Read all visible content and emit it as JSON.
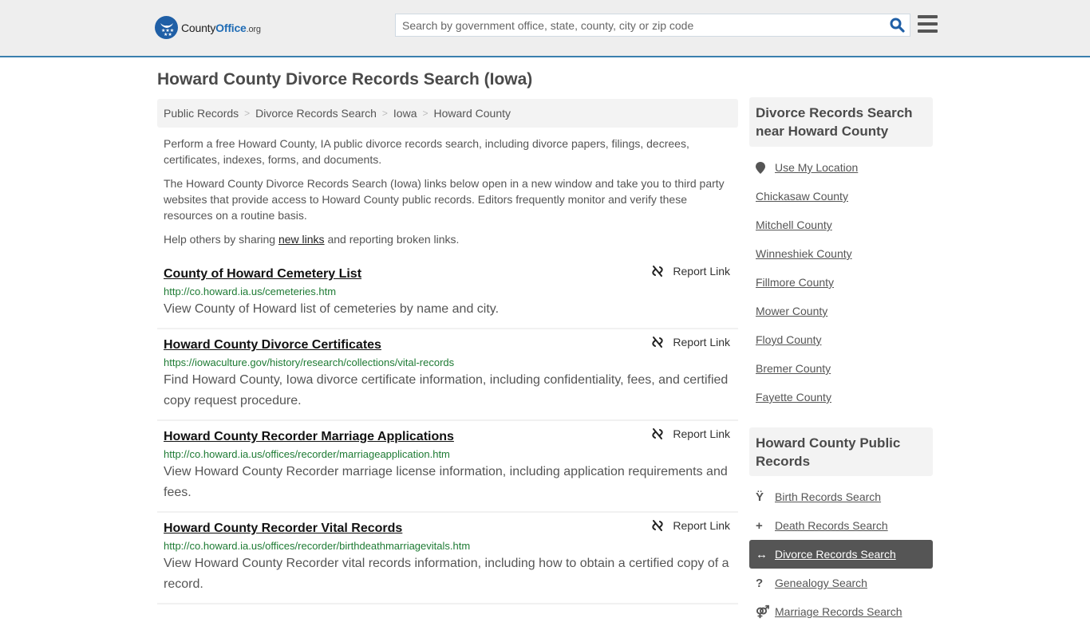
{
  "header": {
    "logo": {
      "part1": "County",
      "part2": "Office",
      "part3": ".org"
    },
    "search": {
      "placeholder": "Search by government office, state, county, city or zip code",
      "value": ""
    },
    "icons": {
      "search": "search-icon",
      "menu": "hamburger-menu-icon"
    }
  },
  "page": {
    "title": "Howard County Divorce Records Search (Iowa)",
    "breadcrumb": [
      "Public Records",
      "Divorce Records Search",
      "Iowa",
      "Howard County"
    ],
    "intro": {
      "p1": "Perform a free Howard County, IA public divorce records search, including divorce papers, filings, decrees, certificates, indexes, forms, and documents.",
      "p2": "The Howard County Divorce Records Search (Iowa) links below open in a new window and take you to third party websites that provide access to Howard County public records. Editors frequently monitor and verify these resources on a routine basis.",
      "p3_before": "Help others by sharing ",
      "p3_link": "new links",
      "p3_after": " and reporting broken links."
    }
  },
  "results": [
    {
      "title": "County of Howard Cemetery List",
      "url": "http://co.howard.ia.us/cemeteries.htm",
      "description": "View County of Howard list of cemeteries by name and city.",
      "report_label": "Report Link"
    },
    {
      "title": "Howard County Divorce Certificates",
      "url": "https://iowaculture.gov/history/research/collections/vital-records",
      "description": "Find Howard County, Iowa divorce certificate information, including confidentiality, fees, and certified copy request procedure.",
      "report_label": "Report Link"
    },
    {
      "title": "Howard County Recorder Marriage Applications",
      "url": "http://co.howard.ia.us/offices/recorder/marriageapplication.htm",
      "description": "View Howard County Recorder marriage license information, including application requirements and fees.",
      "report_label": "Report Link"
    },
    {
      "title": "Howard County Recorder Vital Records",
      "url": "http://co.howard.ia.us/offices/recorder/birthdeathmarriagevitals.htm",
      "description": "View Howard County Recorder vital records information, including how to obtain a certified copy of a record.",
      "report_label": "Report Link"
    }
  ],
  "sidebar": {
    "nearby": {
      "heading": "Divorce Records Search near Howard County",
      "use_location": "Use My Location",
      "counties": [
        "Chickasaw County",
        "Mitchell County",
        "Winneshiek County",
        "Fillmore County",
        "Mower County",
        "Floyd County",
        "Bremer County",
        "Fayette County"
      ]
    },
    "public_records": {
      "heading": "Howard County Public Records",
      "items": [
        {
          "label": "Birth Records Search",
          "icon": "child-icon",
          "glyph": "Ÿ",
          "active": false
        },
        {
          "label": "Death Records Search",
          "icon": "cross-icon",
          "glyph": "+",
          "active": false
        },
        {
          "label": "Divorce Records Search",
          "icon": "arrows-horizontal-icon",
          "glyph": "↔",
          "active": true
        },
        {
          "label": "Genealogy Search",
          "icon": "question-icon",
          "glyph": "?",
          "active": false
        },
        {
          "label": "Marriage Records Search",
          "icon": "marriage-icon",
          "glyph": "⚤",
          "active": false
        }
      ]
    }
  },
  "colors": {
    "accent": "#3a7fae",
    "brand_blue": "#1f5fa6",
    "url_green": "#1e7b34",
    "active_bg": "#555555"
  }
}
